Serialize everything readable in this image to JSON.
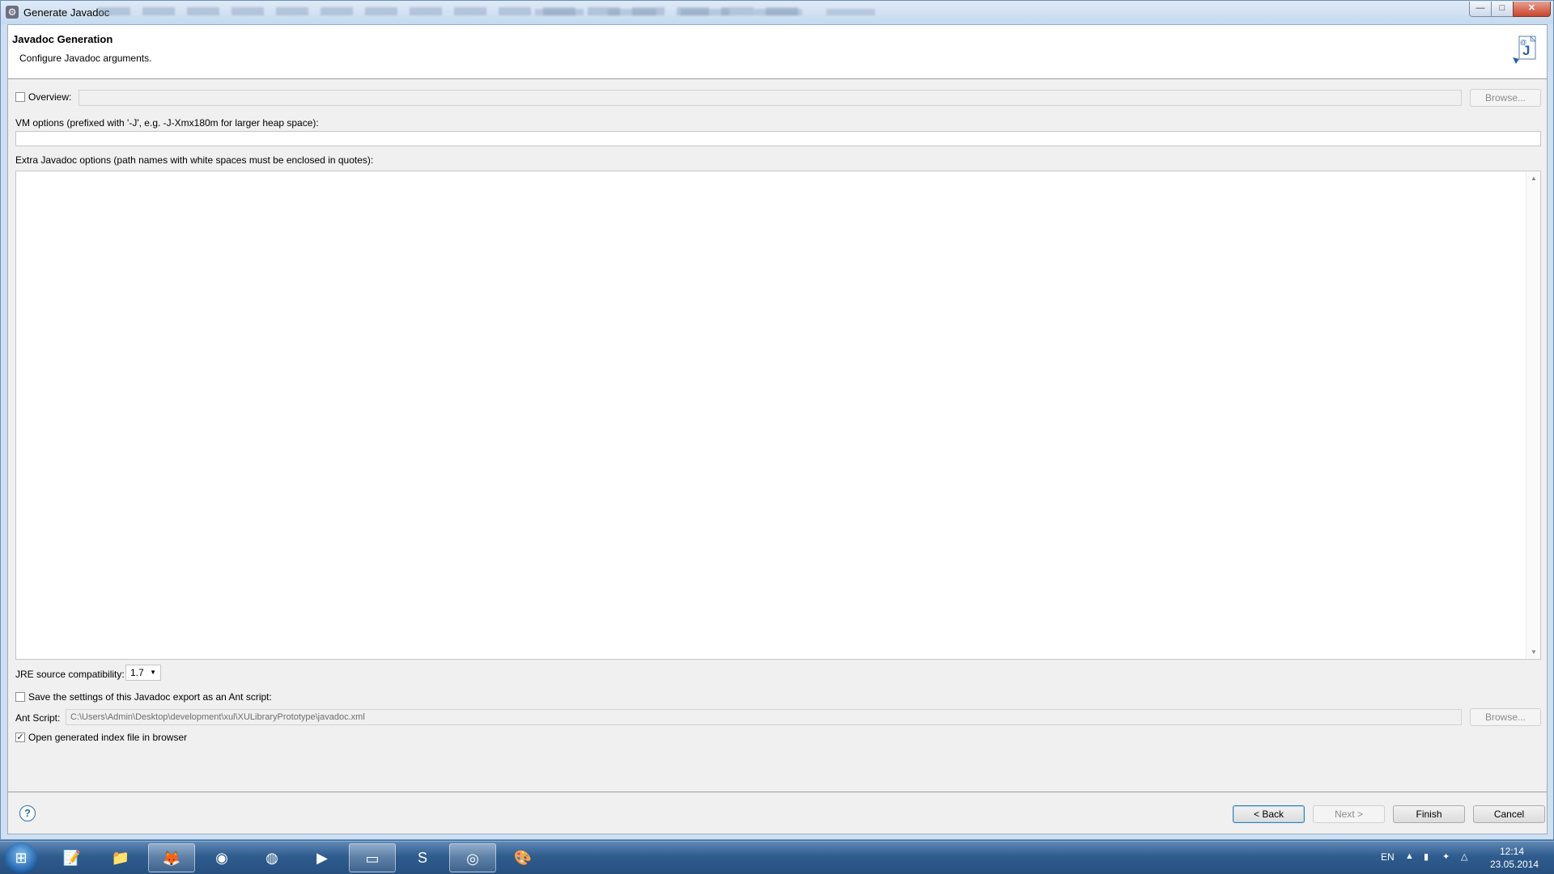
{
  "window": {
    "title": "Generate Javadoc",
    "controls": {
      "minimize": "—",
      "maximize": "□",
      "close": "✕"
    }
  },
  "header": {
    "title": "Javadoc Generation",
    "description": "Configure Javadoc arguments.",
    "image_icon": "javadoc-wizard-icon"
  },
  "overview": {
    "label": "Overview:",
    "checked": false,
    "value": "",
    "browse_label": "Browse..."
  },
  "vm_options": {
    "label": "VM options (prefixed with '-J', e.g. -J-Xmx180m for larger heap space):",
    "value": ""
  },
  "extra_options": {
    "label": "Extra Javadoc options (path names with white spaces must be enclosed in quotes):",
    "value": ""
  },
  "jre": {
    "label": "JRE source compatibility:",
    "selected": "1.7"
  },
  "ant": {
    "save_label": "Save the settings of this Javadoc export as an Ant script:",
    "save_checked": false,
    "script_label": "Ant Script:",
    "script_value": "C:\\Users\\Admin\\Desktop\\development\\xul\\XULibraryPrototype\\javadoc.xml",
    "browse_label": "Browse..."
  },
  "open_index": {
    "label": "Open generated index file in browser",
    "checked": true
  },
  "footer": {
    "back_label": "< Back",
    "next_label": "Next >",
    "finish_label": "Finish",
    "cancel_label": "Cancel"
  },
  "taskbar": {
    "items": [
      "start-orb",
      "notepad",
      "file-explorer",
      "firefox",
      "chrome",
      "tor-browser",
      "media-player",
      "command-prompt",
      "skype",
      "eclipse",
      "paint"
    ],
    "language": "EN",
    "time": "12:14",
    "date": "23.05.2014"
  },
  "colors": {
    "title_bar": "#cfe0f3",
    "taskbar": "#2f5c8e",
    "accent": "#3c7fb1"
  }
}
